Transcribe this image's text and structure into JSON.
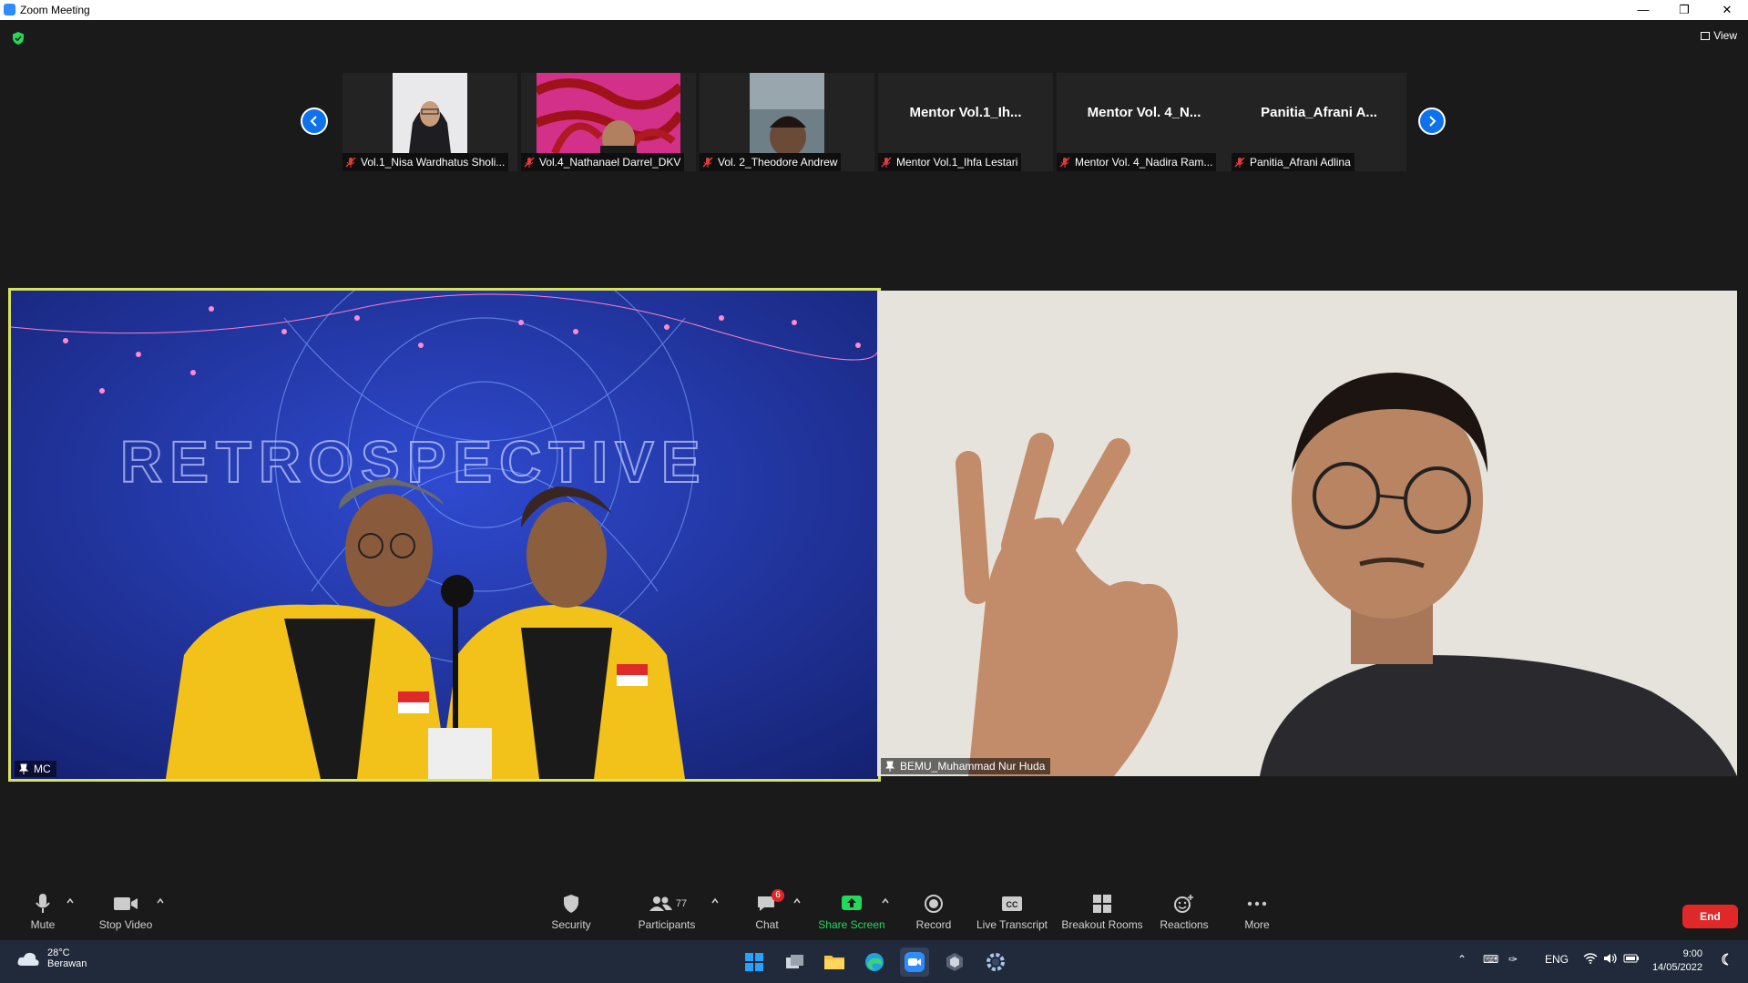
{
  "window": {
    "title": "Zoom Meeting"
  },
  "top_bar": {
    "view_label": "View"
  },
  "thumbnails": [
    {
      "name": "Vol.1_Nisa Wardhatus Sholi...",
      "label": ""
    },
    {
      "name": "Vol.4_Nathanael Darrel_DKV",
      "label": ""
    },
    {
      "name": "Vol. 2_Theodore Andrew",
      "label": ""
    },
    {
      "name": "Mentor Vol.1_Ihfa Lestari",
      "label": "Mentor  Vol.1_Ih..."
    },
    {
      "name": "Mentor Vol. 4_Nadira Ram...",
      "label": "Mentor  Vol. 4_N..."
    },
    {
      "name": "Panitia_Afrani Adlina",
      "label": "Panitia_Afrani  A..."
    }
  ],
  "main_videos": [
    {
      "name": "MC"
    },
    {
      "name": "BEMU_Muhammad Nur Huda"
    }
  ],
  "toolbar": {
    "mute": "Mute",
    "stop_video": "Stop Video",
    "security": "Security",
    "participants": "Participants",
    "participants_count": "77",
    "chat": "Chat",
    "chat_badge": "6",
    "share_screen": "Share Screen",
    "record": "Record",
    "live_transcript": "Live Transcript",
    "breakout_rooms": "Breakout Rooms",
    "reactions": "Reactions",
    "more": "More",
    "end": "End"
  },
  "taskbar": {
    "temperature": "28°C",
    "weather_desc": "Berawan",
    "language": "ENG",
    "time": "9:00",
    "date": "14/05/2022"
  },
  "colors": {
    "accent_blue": "#0e72ed",
    "share_green": "#23d959",
    "end_red": "#e02828",
    "active_speaker": "#d8e25a"
  }
}
